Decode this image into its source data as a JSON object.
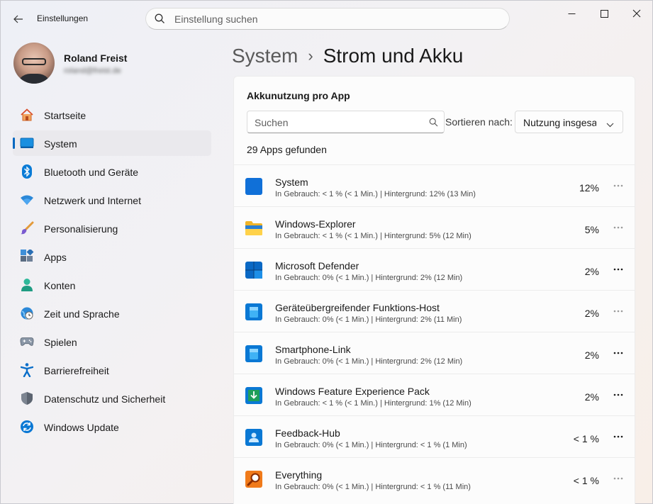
{
  "window": {
    "title": "Einstellungen",
    "search_placeholder": "Einstellung suchen"
  },
  "profile": {
    "name": "Roland Freist",
    "email": "roland@freist.de"
  },
  "sidebar": {
    "items": [
      {
        "label": "Startseite",
        "icon": "home-icon"
      },
      {
        "label": "System",
        "icon": "system-display-icon",
        "selected": true
      },
      {
        "label": "Bluetooth und Geräte",
        "icon": "bluetooth-icon"
      },
      {
        "label": "Netzwerk und Internet",
        "icon": "wifi-icon"
      },
      {
        "label": "Personalisierung",
        "icon": "paintbrush-icon"
      },
      {
        "label": "Apps",
        "icon": "apps-icon"
      },
      {
        "label": "Konten",
        "icon": "account-icon"
      },
      {
        "label": "Zeit und Sprache",
        "icon": "clock-globe-icon"
      },
      {
        "label": "Spielen",
        "icon": "gamepad-icon"
      },
      {
        "label": "Barrierefreiheit",
        "icon": "accessibility-icon"
      },
      {
        "label": "Datenschutz und Sicherheit",
        "icon": "shield-icon"
      },
      {
        "label": "Windows Update",
        "icon": "windows-update-icon"
      }
    ]
  },
  "header": {
    "parent": "System",
    "separator": "›",
    "current": "Strom und Akku"
  },
  "panel": {
    "title": "Akkunutzung pro App",
    "filter_placeholder": "Suchen",
    "sort_label": "Sortieren nach:",
    "sort_value": "Nutzung insgesa",
    "apps_found": "29 Apps gefunden",
    "apps": [
      {
        "name": "System",
        "detail": "In Gebrauch: < 1 % (< 1 Min.) | Hintergrund: 12% (13 Min)",
        "percent": "12%",
        "icon": "system-app-icon",
        "more_dim": true
      },
      {
        "name": "Windows-Explorer",
        "detail": "In Gebrauch: < 1 % (< 1 Min.) | Hintergrund: 5% (12 Min)",
        "percent": "5%",
        "icon": "folder-icon",
        "more_dim": true
      },
      {
        "name": "Microsoft Defender",
        "detail": "In Gebrauch: 0% (< 1 Min.) | Hintergrund: 2% (12 Min)",
        "percent": "2%",
        "icon": "defender-icon",
        "more_dim": false
      },
      {
        "name": "Geräteübergreifender Funktions-Host",
        "detail": "In Gebrauch: 0% (< 1 Min.) | Hintergrund: 2% (11 Min)",
        "percent": "2%",
        "icon": "generic-app-icon",
        "more_dim": true
      },
      {
        "name": "Smartphone-Link",
        "detail": "In Gebrauch: 0% (< 1 Min.) | Hintergrund: 2% (12 Min)",
        "percent": "2%",
        "icon": "generic-app-icon",
        "more_dim": false
      },
      {
        "name": "Windows Feature Experience Pack",
        "detail": "In Gebrauch: < 1 % (< 1 Min.) | Hintergrund: 1% (12 Min)",
        "percent": "2%",
        "icon": "download-app-icon",
        "more_dim": false
      },
      {
        "name": "Feedback-Hub",
        "detail": "In Gebrauch: 0% (< 1 Min.) | Hintergrund: < 1 % (1 Min)",
        "percent": "< 1 %",
        "icon": "feedback-icon",
        "more_dim": false
      },
      {
        "name": "Everything",
        "detail": "In Gebrauch: 0% (< 1 Min.) | Hintergrund: < 1 % (11 Min)",
        "percent": "< 1 %",
        "icon": "magnifier-app-icon",
        "more_dim": true
      }
    ]
  }
}
